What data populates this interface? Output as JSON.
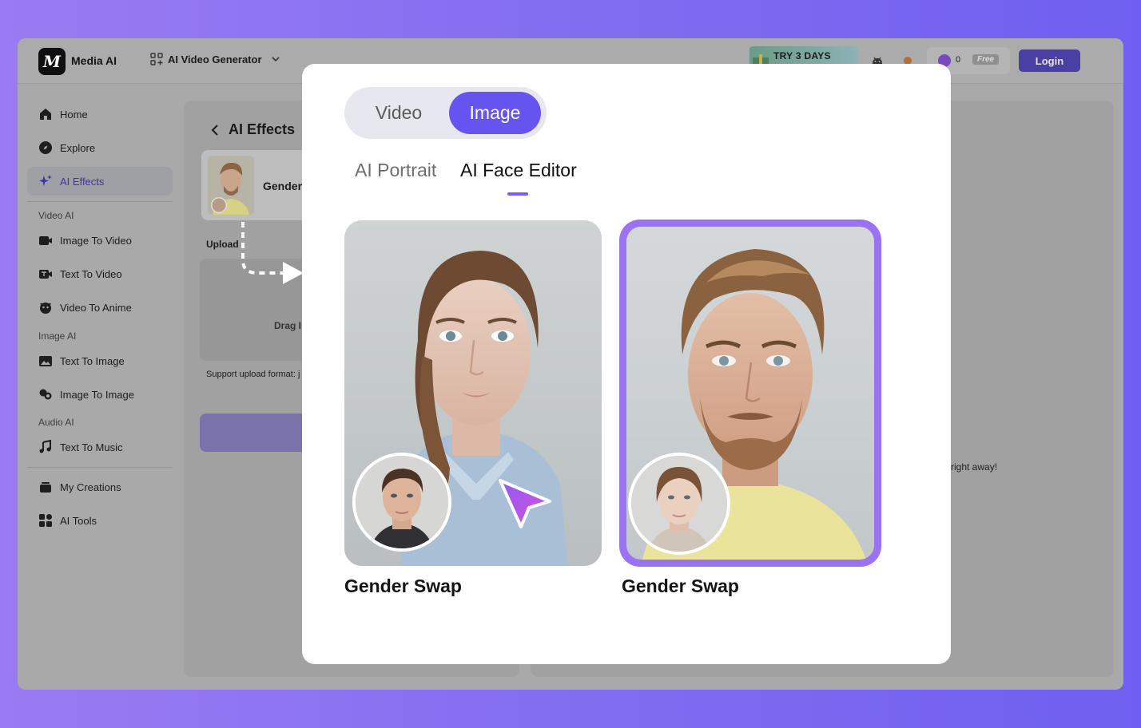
{
  "topbar": {
    "logo_glyph": "M",
    "logo_text": "Media AI",
    "generator_menu": "AI Video Generator",
    "promo_text": "TRY 3 DAYS",
    "credits_count": "0",
    "free_badge": "Free",
    "login_label": "Login"
  },
  "sidebar": {
    "items": [
      {
        "label": "Home",
        "icon": "home-icon"
      },
      {
        "label": "Explore",
        "icon": "compass-icon"
      },
      {
        "label": "AI Effects",
        "icon": "sparkle-icon"
      }
    ],
    "video_ai_label": "Video AI",
    "video_ai_items": [
      {
        "label": "Image To Video",
        "icon": "image-video-icon"
      },
      {
        "label": "Text To Video",
        "icon": "text-video-icon"
      },
      {
        "label": "Video To Anime",
        "icon": "anime-icon"
      }
    ],
    "image_ai_label": "Image AI",
    "image_ai_items": [
      {
        "label": "Text To Image",
        "icon": "text-image-icon"
      },
      {
        "label": "Image To Image",
        "icon": "image-image-icon"
      }
    ],
    "audio_ai_label": "Audio AI",
    "audio_ai_items": [
      {
        "label": "Text To Music",
        "icon": "music-icon"
      }
    ],
    "bottom_items": [
      {
        "label": "My Creations",
        "icon": "creations-icon"
      },
      {
        "label": "AI Tools",
        "icon": "tools-icon"
      }
    ]
  },
  "workspace": {
    "back_title": "AI Effects",
    "effect_card_name": "Gender",
    "upload_label": "Upload",
    "drop_text": "Drag I",
    "support_text": "Support upload format: j",
    "right_hint": "right away!"
  },
  "modal": {
    "segment": {
      "video": "Video",
      "image": "Image",
      "selected": "Image"
    },
    "tabs": {
      "portrait": "AI Portrait",
      "face_editor": "AI Face Editor",
      "selected": "AI Face Editor"
    },
    "cards": [
      {
        "label": "Gender Swap"
      },
      {
        "label": "Gender Swap"
      }
    ]
  },
  "colors": {
    "accent": "#6654f0",
    "selection_border": "#9a72f3",
    "login_button": "#4a3fa3",
    "background_gradient_start": "#9a7bf3",
    "background_gradient_end": "#6f5ff0"
  }
}
